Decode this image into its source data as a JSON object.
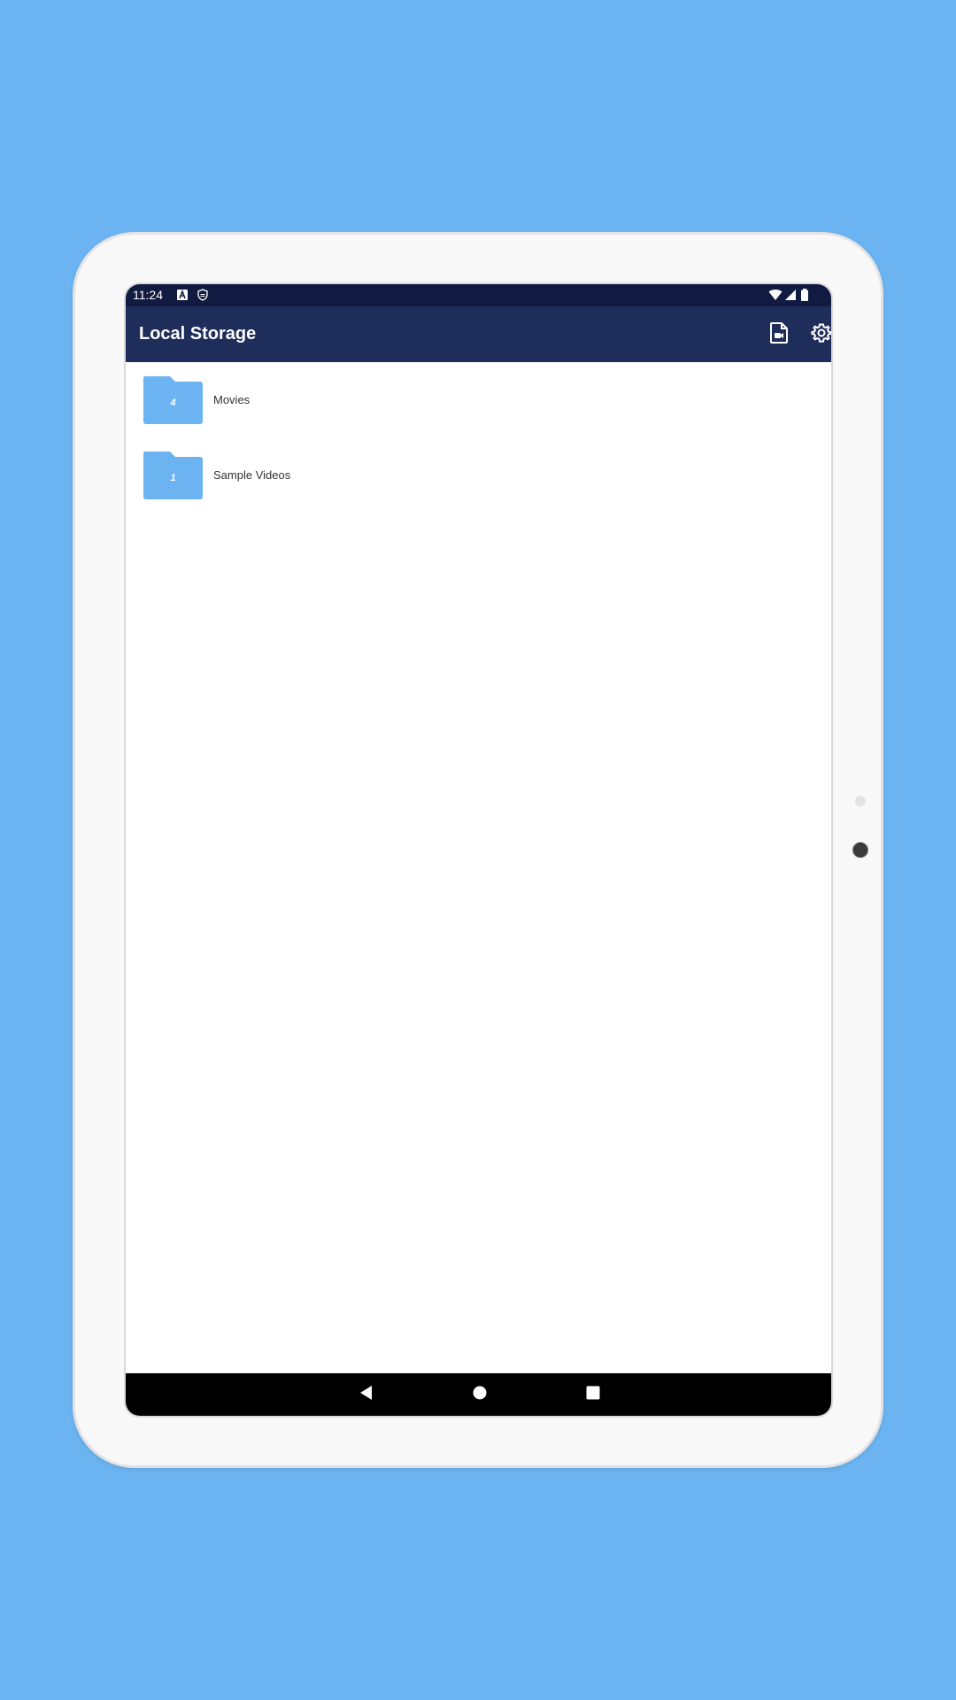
{
  "status_bar": {
    "time": "11:24",
    "left_icons": [
      "font-a-icon",
      "shield-icon"
    ],
    "right_icons": [
      "wifi-icon",
      "signal-icon",
      "battery-icon"
    ]
  },
  "app_bar": {
    "title": "Local Storage",
    "actions": [
      "document-media-icon",
      "settings-gear-icon"
    ],
    "color": "#1f2d5a"
  },
  "folders": [
    {
      "name": "Movies",
      "count": "4"
    },
    {
      "name": "Sample Videos",
      "count": "1"
    }
  ],
  "folder_color": "#6bb4f1",
  "navigation_bar": [
    "back-icon",
    "home-icon",
    "recents-icon"
  ]
}
